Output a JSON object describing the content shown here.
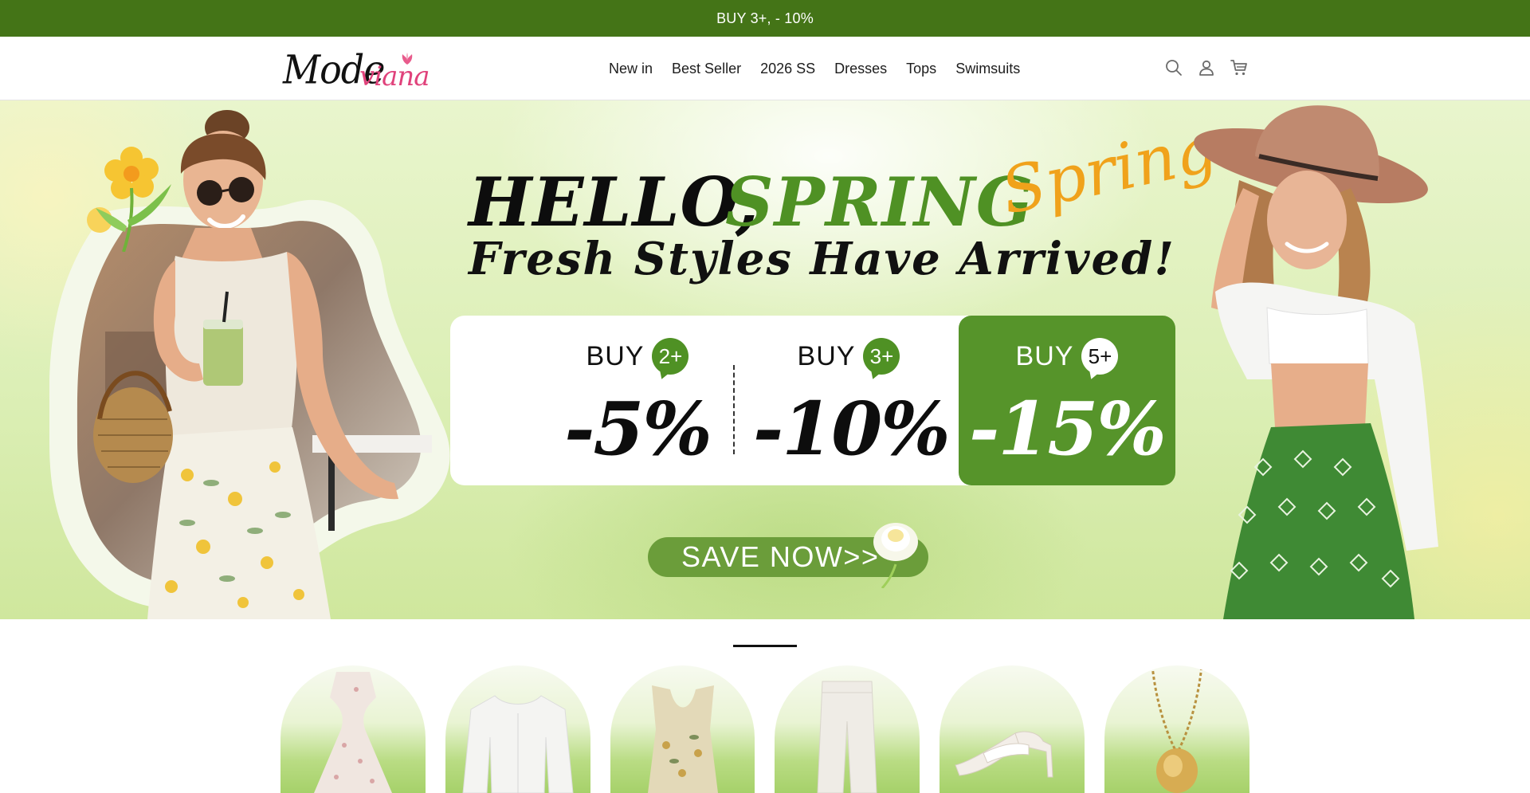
{
  "announcement": {
    "text": "BUY 3+, - 10%"
  },
  "header": {
    "logo": {
      "part1": "Mode",
      "part2": "viana"
    },
    "nav": [
      "New in",
      "Best Seller",
      "2026 SS",
      "Dresses",
      "Tops",
      "Swimsuits"
    ],
    "icons": [
      "search-icon",
      "account-icon",
      "cart-icon"
    ]
  },
  "hero": {
    "headline_hello": "HELLO,",
    "headline_spring": "SPRING",
    "script_word": "Spring",
    "subheadline": "Fresh Styles Have Arrived!",
    "offers": [
      {
        "buy": "BUY",
        "qty": "2+",
        "discount": "-5%"
      },
      {
        "buy": "BUY",
        "qty": "3+",
        "discount": "-10%"
      },
      {
        "buy": "BUY",
        "qty": "5+",
        "discount": "-15%"
      }
    ],
    "cta": "SAVE NOW>>"
  },
  "categories": {
    "items": [
      "floral-dress",
      "white-blouse",
      "floral-top",
      "white-pants",
      "white-heels",
      "gold-necklace"
    ]
  },
  "colors": {
    "brand_green": "#447417",
    "accent_green": "#4f9124",
    "logo_pink": "#e0427b",
    "script_orange": "#f0a21b"
  }
}
